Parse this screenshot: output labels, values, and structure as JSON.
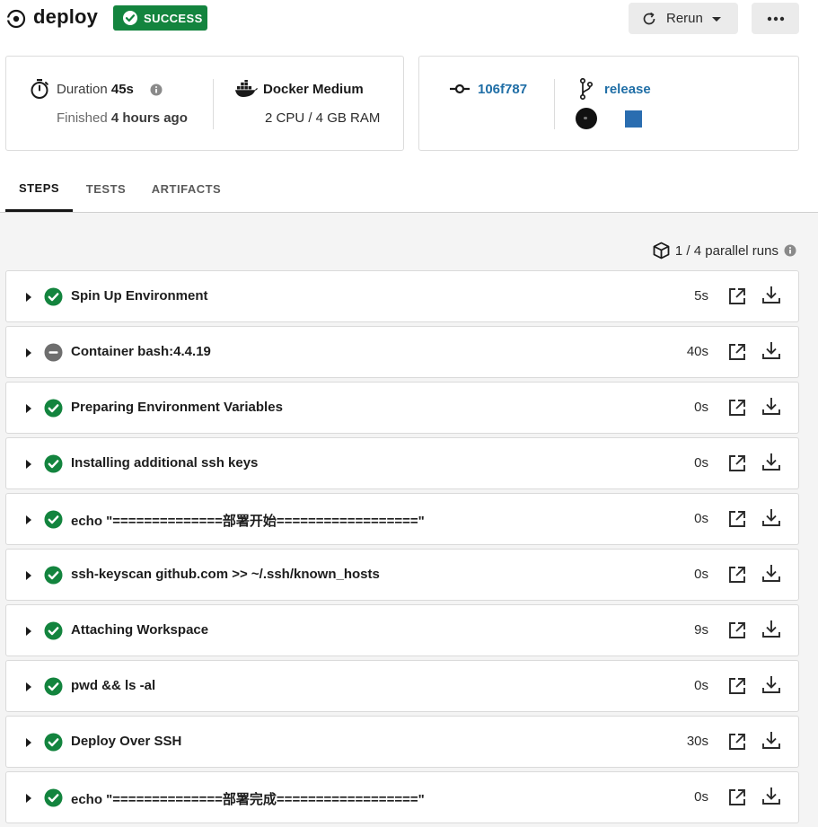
{
  "header": {
    "title": "deploy",
    "status": "SUCCESS",
    "rerun_label": "Rerun"
  },
  "summary": {
    "duration_label": "Duration",
    "duration_value": "45s",
    "finished_label": "Finished",
    "finished_value": "4 hours ago",
    "executor": "Docker Medium",
    "resources": "2 CPU / 4 GB RAM",
    "commit": "106f787",
    "branch": "release"
  },
  "tabs": [
    "STEPS",
    "TESTS",
    "ARTIFACTS"
  ],
  "parallel_runs": "1 / 4 parallel runs",
  "steps": [
    {
      "label": "Spin Up Environment",
      "duration": "5s",
      "status": "success"
    },
    {
      "label": "Container bash:4.4.19",
      "duration": "40s",
      "status": "neutral"
    },
    {
      "label": "Preparing Environment Variables",
      "duration": "0s",
      "status": "success"
    },
    {
      "label": "Installing additional ssh keys",
      "duration": "0s",
      "status": "success"
    },
    {
      "label": "echo \"==============部署开始==================\"",
      "duration": "0s",
      "status": "success"
    },
    {
      "label": "ssh-keyscan github.com >> ~/.ssh/known_hosts",
      "duration": "0s",
      "status": "success"
    },
    {
      "label": "Attaching Workspace",
      "duration": "9s",
      "status": "success"
    },
    {
      "label": "pwd && ls -al",
      "duration": "0s",
      "status": "success"
    },
    {
      "label": "Deploy Over SSH",
      "duration": "30s",
      "status": "success"
    },
    {
      "label": "echo \"==============部署完成==================\"",
      "duration": "0s",
      "status": "success"
    }
  ],
  "colors": {
    "success": "#13843e",
    "neutral": "#6e6e6e",
    "link": "#1f6ea6"
  }
}
